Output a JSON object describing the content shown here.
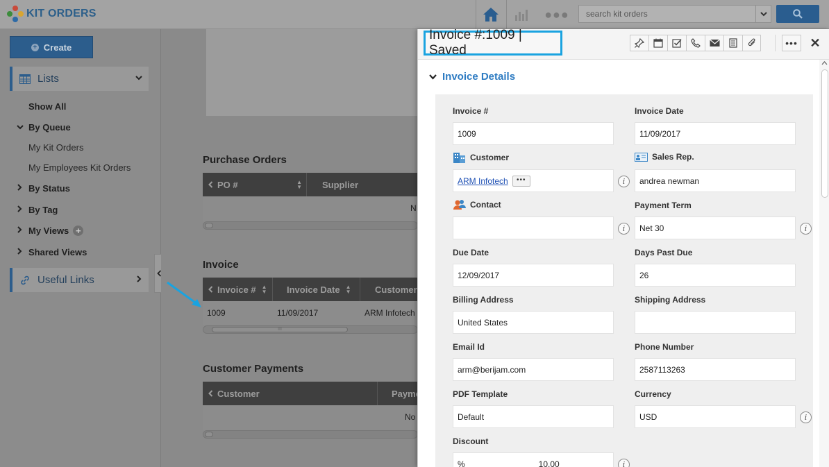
{
  "app": {
    "title": "KIT ORDERS"
  },
  "search": {
    "placeholder": "search kit orders"
  },
  "sidebar": {
    "create_label": "Create",
    "lists_label": "Lists",
    "useful_links_label": "Useful Links",
    "items": {
      "show_all": "Show All",
      "by_queue": "By Queue",
      "my_kit_orders": "My Kit Orders",
      "my_employees_kit_orders": "My Employees Kit Orders",
      "by_status": "By Status",
      "by_tag": "By Tag",
      "my_views": "My Views",
      "shared_views": "Shared Views"
    }
  },
  "main": {
    "purchase_orders": {
      "title": "Purchase Orders",
      "columns": [
        "PO #",
        "Supplier"
      ],
      "empty_text": "N"
    },
    "invoice": {
      "title": "Invoice",
      "columns": [
        "Invoice #",
        "Invoice Date",
        "Customer"
      ],
      "row": {
        "invoice_no": "1009",
        "invoice_date": "11/09/2017",
        "customer": "ARM Infotech"
      },
      "scroll_grip": "III"
    },
    "customer_payments": {
      "title": "Customer Payments",
      "columns": [
        "Customer",
        "Payme"
      ],
      "empty_text": "No"
    }
  },
  "panel": {
    "title": "Invoice #:1009 | Saved",
    "section_title": "Invoice Details",
    "fields": {
      "invoice_no": {
        "label": "Invoice #",
        "value": "1009"
      },
      "invoice_date": {
        "label": "Invoice Date",
        "value": "11/09/2017"
      },
      "customer": {
        "label": "Customer",
        "value": "ARM Infotech"
      },
      "sales_rep": {
        "label": "Sales Rep.",
        "value": "andrea newman"
      },
      "contact": {
        "label": "Contact",
        "value": ""
      },
      "payment_term": {
        "label": "Payment Term",
        "value": "Net 30"
      },
      "due_date": {
        "label": "Due Date",
        "value": "12/09/2017"
      },
      "days_past_due": {
        "label": "Days Past Due",
        "value": "26"
      },
      "billing_address": {
        "label": "Billing Address",
        "value": "United States"
      },
      "shipping_address": {
        "label": "Shipping Address",
        "value": ""
      },
      "email_id": {
        "label": "Email Id",
        "value": "arm@berijam.com"
      },
      "phone_number": {
        "label": "Phone Number",
        "value": "2587113263"
      },
      "pdf_template": {
        "label": "PDF Template",
        "value": "Default"
      },
      "currency": {
        "label": "Currency",
        "value": "USD"
      },
      "discount": {
        "label": "Discount",
        "unit": "%",
        "value": "10.00"
      }
    }
  },
  "colors": {
    "accent": "#2c5d8c",
    "highlight": "#1aa3e0",
    "link": "#2d7bc2"
  }
}
